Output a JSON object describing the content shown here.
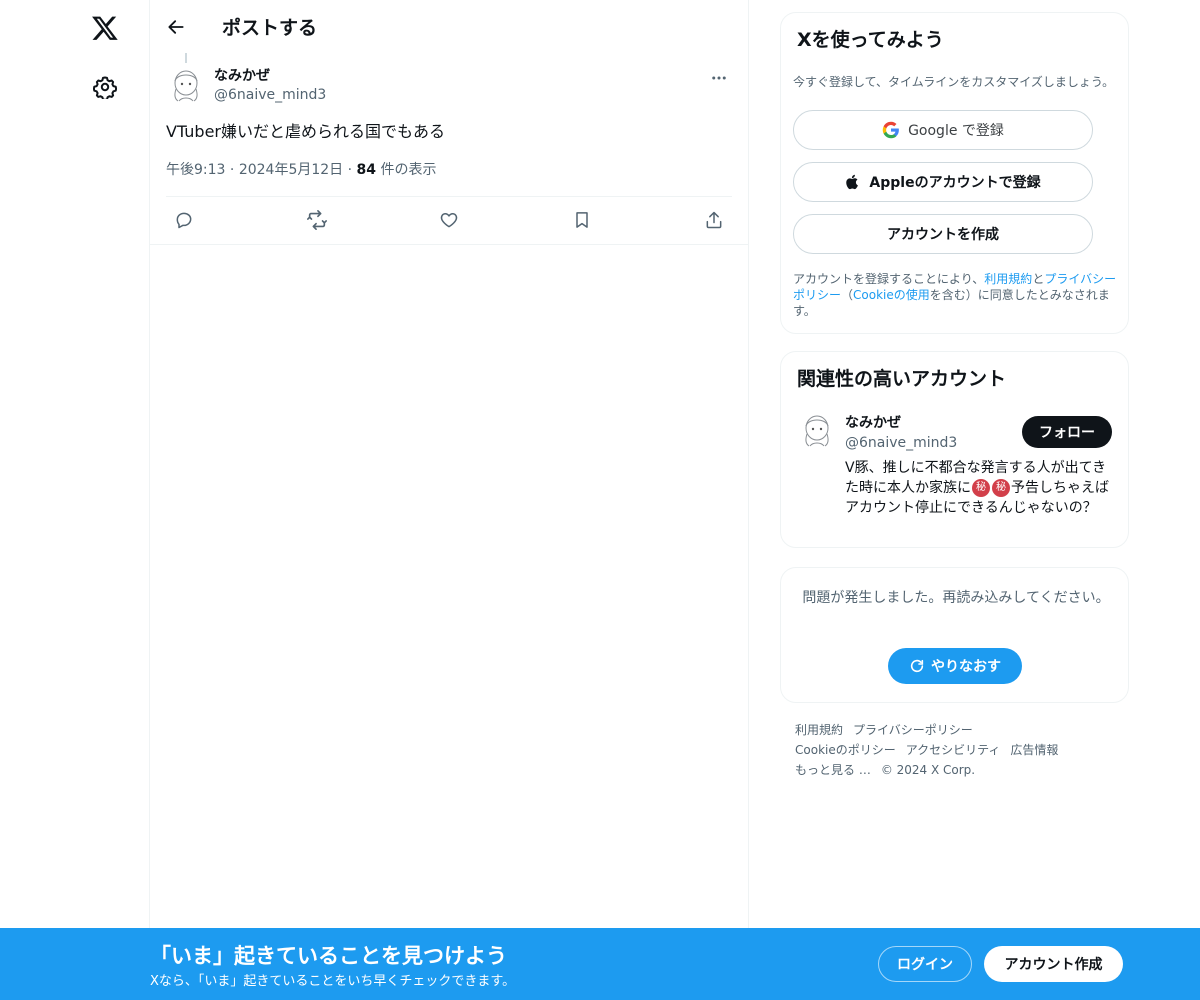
{
  "nav": {
    "logo_icon": "x-logo-icon",
    "settings_icon": "gear-icon"
  },
  "header": {
    "title": "ポストする"
  },
  "post": {
    "author_name": "なみかぜ",
    "author_handle": "@6naive_mind3",
    "text": "VTuber嫌いだと虐められる国でもある",
    "time": "午後9:13",
    "date": "2024年5月12日",
    "view_count": "84",
    "view_label": "件の表示"
  },
  "signup": {
    "title": "Xを使ってみよう",
    "description": "今すぐ登録して、タイムラインをカスタマイズしましょう。",
    "google_label": "Google で登録",
    "apple_label": "Appleのアカウントで登録",
    "create_label": "アカウントを作成",
    "terms_prefix": "アカウントを登録することにより、",
    "terms_link": "利用規約",
    "terms_and": "と",
    "privacy_link": "プライバシーポリシー",
    "terms_paren_open": "（",
    "cookie_link": "Cookieの使用",
    "terms_suffix": "を含む）に同意したとみなされます。"
  },
  "related": {
    "title": "関連性の高いアカウント",
    "name": "なみかぜ",
    "handle": "@6naive_mind3",
    "follow_label": "フォロー",
    "bio_1": "V豚、推しに不都合な発言する人が出てきた時に本人か家族に",
    "secret_glyph": "秘",
    "bio_2": "予告しちゃえばアカウント停止にできるんじゃないの？"
  },
  "error": {
    "message": "問題が発生しました。再読み込みしてください。",
    "retry_label": "やりなおす"
  },
  "footer": {
    "links": [
      "利用規約",
      "プライバシーポリシー",
      "Cookieのポリシー",
      "アクセシビリティ",
      "広告情報",
      "もっと見る …",
      "© 2024 X Corp."
    ]
  },
  "banner": {
    "title": "「いま」起きていることを見つけよう",
    "subtitle": "Xなら、「いま」起きていることをいち早くチェックできます。",
    "login_label": "ログイン",
    "create_label": "アカウント作成"
  },
  "colors": {
    "accent": "#1d9bf0",
    "text": "#0f1419",
    "secondary": "#536471",
    "border": "#eff3f4"
  }
}
